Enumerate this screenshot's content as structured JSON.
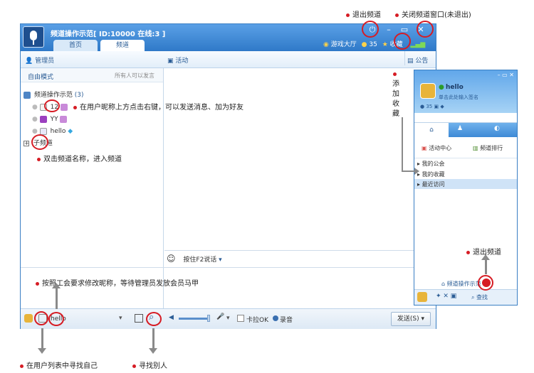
{
  "window": {
    "title": "频道操作示范[ ID:10000 在线:3 ]",
    "tabs": [
      "首页",
      "频道"
    ],
    "lobby": "游戏大厅",
    "coins": "35",
    "favorite": "收藏"
  },
  "toolbar": {
    "admin": "管理员",
    "activity": "活动",
    "announce": "公告"
  },
  "mode": {
    "label": "自由模式",
    "status": "所有人可以发言"
  },
  "tree": {
    "channel_name": "频道操作示范",
    "channel_count": "(3)",
    "users": [
      "12",
      "YY",
      "hello"
    ],
    "subchannel": "子频道"
  },
  "chat": {
    "ptt_label": "按住F2说话"
  },
  "bottombar": {
    "nickname": "hello",
    "karaoke": "卡拉OK",
    "record": "录音",
    "send": "发送(S)"
  },
  "smallwin": {
    "nickname": "hello",
    "signature": "单击此处输入签名",
    "coins": "35",
    "tiles": [
      "活动中心",
      "频道排行"
    ],
    "lists": [
      "我的公会",
      "我的收藏",
      "最近访问"
    ],
    "current_channel": "频道操作示范",
    "search": "查找"
  },
  "annotations": {
    "exit_channel": "退出频道",
    "close_window": "关闭频道窗口(未退出)",
    "add_favorite": "添加收藏",
    "right_click_tip": "在用户昵称上方点击右键，可以发送消息、加为好友",
    "double_click_tip": "双击频道名称，进入频道",
    "rename_tip": "按照工会要求修改昵称，等待管理员发放会员马甲",
    "exit_channel_2": "退出频道",
    "find_self": "在用户列表中寻找自己",
    "find_others": "寻找别人"
  },
  "colors": {
    "accent": "#3a7fc4",
    "annotation_red": "#d61c24"
  }
}
